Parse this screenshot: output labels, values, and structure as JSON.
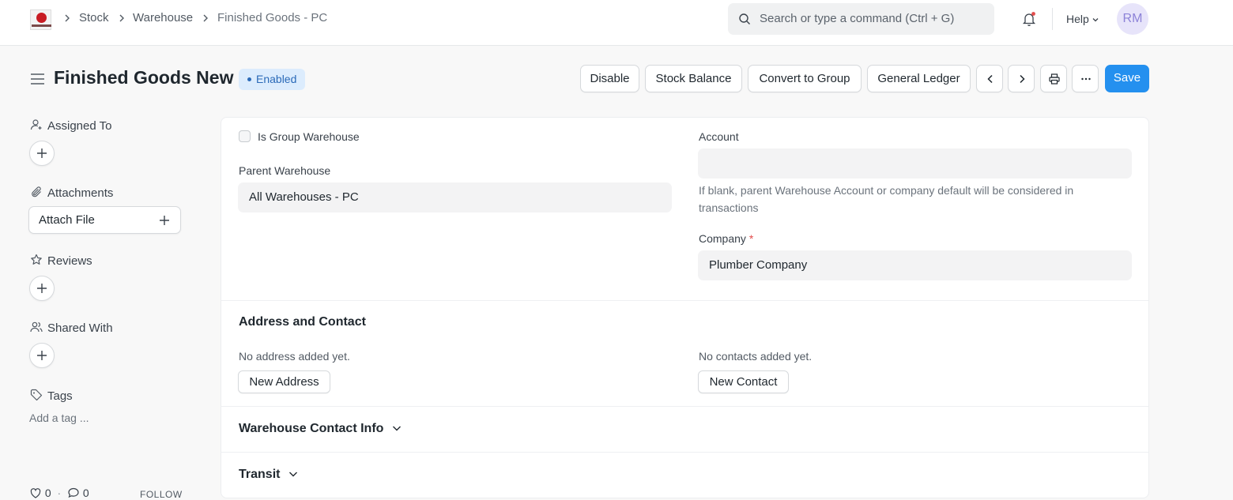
{
  "navbar": {
    "breadcrumbs": [
      "Stock",
      "Warehouse",
      "Finished Goods - PC"
    ],
    "search_placeholder": "Search or type a command (Ctrl + G)",
    "help_label": "Help",
    "avatar_initials": "RM"
  },
  "header": {
    "title": "Finished Goods New",
    "status": "Enabled",
    "buttons": {
      "disable": "Disable",
      "stock_balance": "Stock Balance",
      "convert_to_group": "Convert to Group",
      "general_ledger": "General Ledger",
      "save": "Save"
    }
  },
  "sidebar": {
    "assigned_to": "Assigned To",
    "attachments": "Attachments",
    "attach_file": "Attach File",
    "reviews": "Reviews",
    "shared_with": "Shared With",
    "tags": "Tags",
    "add_tag": "Add a tag ...",
    "likes": "0",
    "comments": "0",
    "follow": "FOLLOW"
  },
  "form": {
    "is_group_label": "Is Group Warehouse",
    "parent_warehouse_label": "Parent Warehouse",
    "parent_warehouse_value": "All Warehouses - PC",
    "account_label": "Account",
    "account_value": "",
    "account_help": "If blank, parent Warehouse Account or company default will be considered in transactions",
    "company_label": "Company",
    "company_required_mark": "*",
    "company_value": "Plumber Company",
    "address_section_title": "Address and Contact",
    "no_address": "No address added yet.",
    "new_address": "New Address",
    "no_contacts": "No contacts added yet.",
    "new_contact": "New Contact",
    "contact_info_section": "Warehouse Contact Info",
    "transit_section": "Transit"
  },
  "colors": {
    "primary": "#2490ef",
    "badge_bg": "#dcecfd",
    "badge_text": "#2b6ab8"
  }
}
